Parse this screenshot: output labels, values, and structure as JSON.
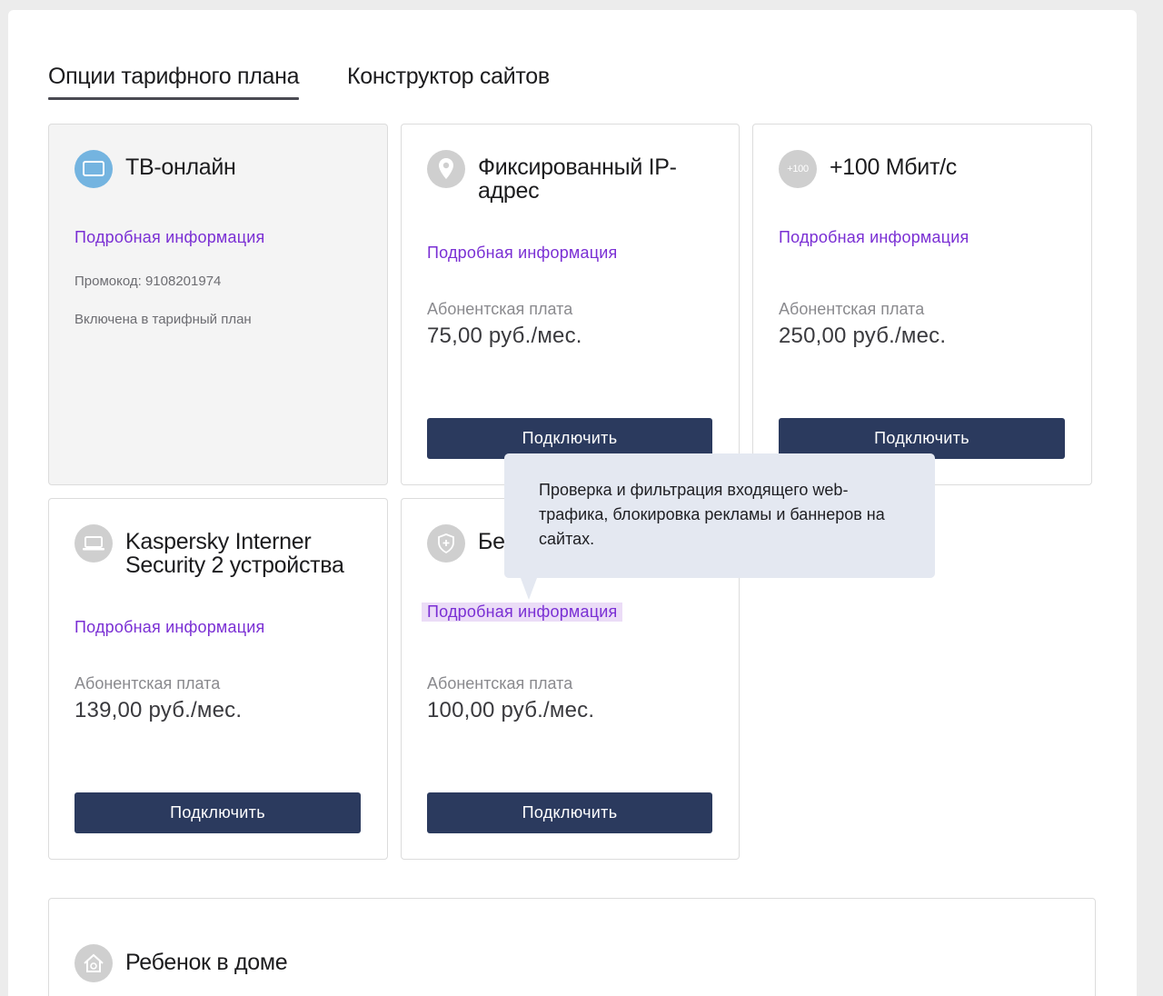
{
  "tabs": [
    {
      "label": "Опции тарифного плана",
      "active": true
    },
    {
      "label": "Конструктор сайтов",
      "active": false
    }
  ],
  "cards": {
    "tv": {
      "icon": "tv-icon",
      "title": "ТВ-онлайн",
      "link": "Подробная информация",
      "promo": "Промокод: 9108201974",
      "status": "Включена в тарифный план"
    },
    "ip": {
      "icon": "location-pin-icon",
      "title": "Фиксированный IP-адрес",
      "link": "Подробная информация",
      "fee_label": "Абонентская плата",
      "fee": "75,00 руб./мес.",
      "button": "Подключить"
    },
    "speed": {
      "icon": "plus-100-icon",
      "icon_text": "+100",
      "title": "+100 Мбит/с",
      "link": "Подробная информация",
      "fee_label": "Абонентская плата",
      "fee": "250,00 руб./мес.",
      "button": "Подключить"
    },
    "kaspersky": {
      "icon": "laptop-icon",
      "title": "Kaspersky Interner Security 2 устройства",
      "link": "Подробная информация",
      "fee_label": "Абонентская плата",
      "fee": "139,00 руб./мес.",
      "button": "Подключить"
    },
    "security": {
      "icon": "shield-icon",
      "title": "Бе",
      "link": "Подробная информация",
      "fee_label": "Абонентская плата",
      "fee": "100,00 руб./мес.",
      "button": "Подключить"
    },
    "child": {
      "icon": "house-icon",
      "title": "Ребенок в доме"
    }
  },
  "tooltip": {
    "text": "Проверка и фильтрация входящего web-трафика, блокировка рекламы и баннеров на сайтах."
  },
  "colors": {
    "accent_link": "#7a2fd4",
    "button_bg": "#2b3a5e",
    "tooltip_bg": "#e4e8f1",
    "tv_icon_bg": "#74b4e0",
    "icon_bg": "#cfcfcf"
  }
}
